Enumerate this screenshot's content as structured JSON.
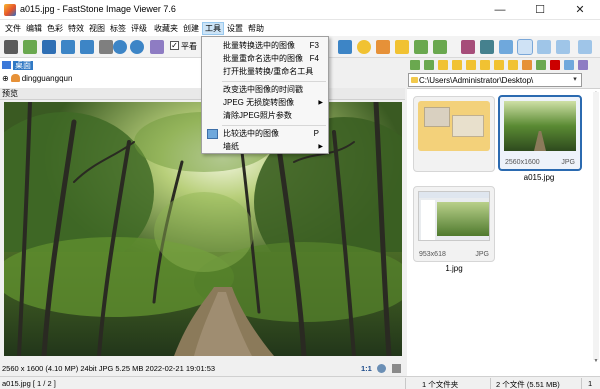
{
  "window": {
    "title": "a015.jpg  -  FastStone Image Viewer 7.6",
    "minimize": "—",
    "maximize": "☐",
    "close": "✕"
  },
  "menubar": {
    "items": [
      "文件",
      "编辑",
      "色彩",
      "特效",
      "视图",
      "标签",
      "评级",
      "收藏夹",
      "创建",
      "工具",
      "设置",
      "帮助"
    ],
    "active": "工具"
  },
  "toolbar": {
    "check_mark": "✓",
    "checkbox_label": "平看"
  },
  "tools_menu": {
    "items": [
      {
        "label": "批量转换选中的图像",
        "shortcut": "F3"
      },
      {
        "label": "批量重命名选中的图像",
        "shortcut": "F4"
      },
      {
        "label": "打开批量转换/重命名工具",
        "shortcut": ""
      },
      {
        "label": "改变选中图像的时间戳",
        "shortcut": ""
      },
      {
        "label": "JPEG 无损旋转图像",
        "shortcut": "",
        "submenu": true
      },
      {
        "label": "清除JPEG照片参数",
        "shortcut": ""
      },
      {
        "label": "比较选中的图像",
        "shortcut": "P"
      },
      {
        "label": "墙纸",
        "shortcut": "",
        "submenu": true
      }
    ],
    "submenu_arrow": "▶"
  },
  "folder_tree": {
    "items": [
      {
        "label": "桌面",
        "expander": "",
        "selected": true
      },
      {
        "label": "dingguangqun",
        "expander": "⊕",
        "selected": false
      }
    ]
  },
  "preview": {
    "label": "预览",
    "info": "2560 x 1600 (4.10 MP)  24bit  JPG  5.25 MB   2022-02-21 19:01:53",
    "zoom": "1:1"
  },
  "browser": {
    "path": "C:\\Users\\Administrator\\Desktop\\",
    "dropdown_arrow": "▾",
    "scroll_up": "▲",
    "scroll_down": "▼",
    "thumbnails": [
      {
        "name": "",
        "dims": "",
        "type": "",
        "selected": false
      },
      {
        "name": "a015.jpg",
        "dims": "2560x1600",
        "type": "JPG",
        "selected": true
      },
      {
        "name": "1.jpg",
        "dims": "953x618",
        "type": "JPG",
        "selected": false
      }
    ]
  },
  "statusbar": {
    "file": "a015.jpg [ 1 / 2 ]",
    "folders": "1 个文件夹",
    "files": "2 个文件 (5.51 MB)",
    "selected": "1"
  },
  "colors": {
    "accent": "#2b6ab0",
    "selection": "#3179c4",
    "menu_highlight": "#cce4f7"
  }
}
